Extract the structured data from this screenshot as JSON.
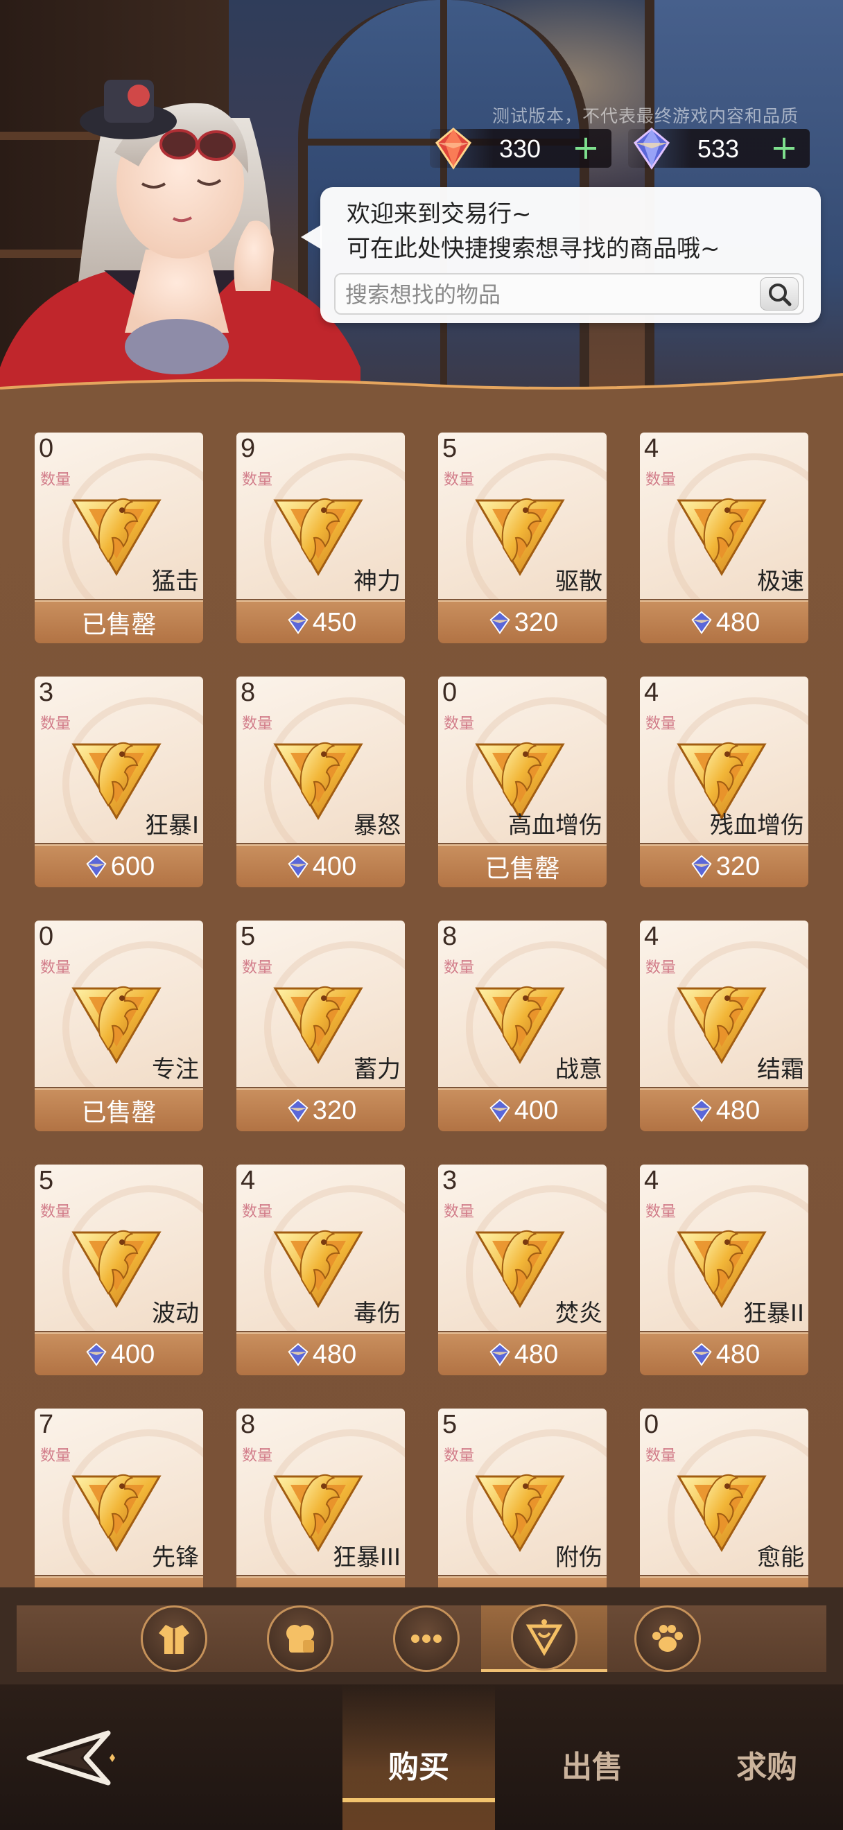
{
  "header": {
    "test_notice": "测试版本，不代表最终游戏内容和品质",
    "currency_red": {
      "amount": "330",
      "plus": "+",
      "icon": "red-crystal-icon"
    },
    "currency_blue": {
      "amount": "533",
      "plus": "+",
      "icon": "blue-crystal-icon"
    }
  },
  "bubble": {
    "greeting_line1": "欢迎来到交易行~",
    "greeting_line2": "可在此处快捷搜索想寻找的商品哦~",
    "search_placeholder": "搜索想找的物品"
  },
  "count_label": "数量",
  "sold_out_label": "已售罄",
  "items": [
    {
      "count": "0",
      "name": "猛击",
      "price": "",
      "sold_out": true
    },
    {
      "count": "9",
      "name": "神力",
      "price": "450",
      "sold_out": false
    },
    {
      "count": "5",
      "name": "驱散",
      "price": "320",
      "sold_out": false
    },
    {
      "count": "4",
      "name": "极速",
      "price": "480",
      "sold_out": false
    },
    {
      "count": "3",
      "name": "狂暴I",
      "price": "600",
      "sold_out": false
    },
    {
      "count": "8",
      "name": "暴怒",
      "price": "400",
      "sold_out": false
    },
    {
      "count": "0",
      "name": "高血增伤",
      "price": "",
      "sold_out": true
    },
    {
      "count": "4",
      "name": "残血增伤",
      "price": "320",
      "sold_out": false
    },
    {
      "count": "0",
      "name": "专注",
      "price": "",
      "sold_out": true
    },
    {
      "count": "5",
      "name": "蓄力",
      "price": "320",
      "sold_out": false
    },
    {
      "count": "8",
      "name": "战意",
      "price": "400",
      "sold_out": false
    },
    {
      "count": "4",
      "name": "结霜",
      "price": "480",
      "sold_out": false
    },
    {
      "count": "5",
      "name": "波动",
      "price": "400",
      "sold_out": false
    },
    {
      "count": "4",
      "name": "毒伤",
      "price": "480",
      "sold_out": false
    },
    {
      "count": "3",
      "name": "焚炎",
      "price": "480",
      "sold_out": false
    },
    {
      "count": "4",
      "name": "狂暴II",
      "price": "480",
      "sold_out": false
    },
    {
      "count": "7",
      "name": "先锋",
      "price": "",
      "sold_out": false
    },
    {
      "count": "8",
      "name": "狂暴III",
      "price": "",
      "sold_out": false
    },
    {
      "count": "5",
      "name": "附伤",
      "price": "",
      "sold_out": false
    },
    {
      "count": "0",
      "name": "愈能",
      "price": "",
      "sold_out": false
    }
  ],
  "categories": [
    {
      "icon": "outfit-icon",
      "active": false
    },
    {
      "icon": "food-icon",
      "active": false
    },
    {
      "icon": "more-icon",
      "active": false
    },
    {
      "icon": "emblem-icon",
      "active": true
    },
    {
      "icon": "paw-icon",
      "active": false
    }
  ],
  "nav": {
    "buy": "购买",
    "sell": "出售",
    "request": "求购"
  }
}
